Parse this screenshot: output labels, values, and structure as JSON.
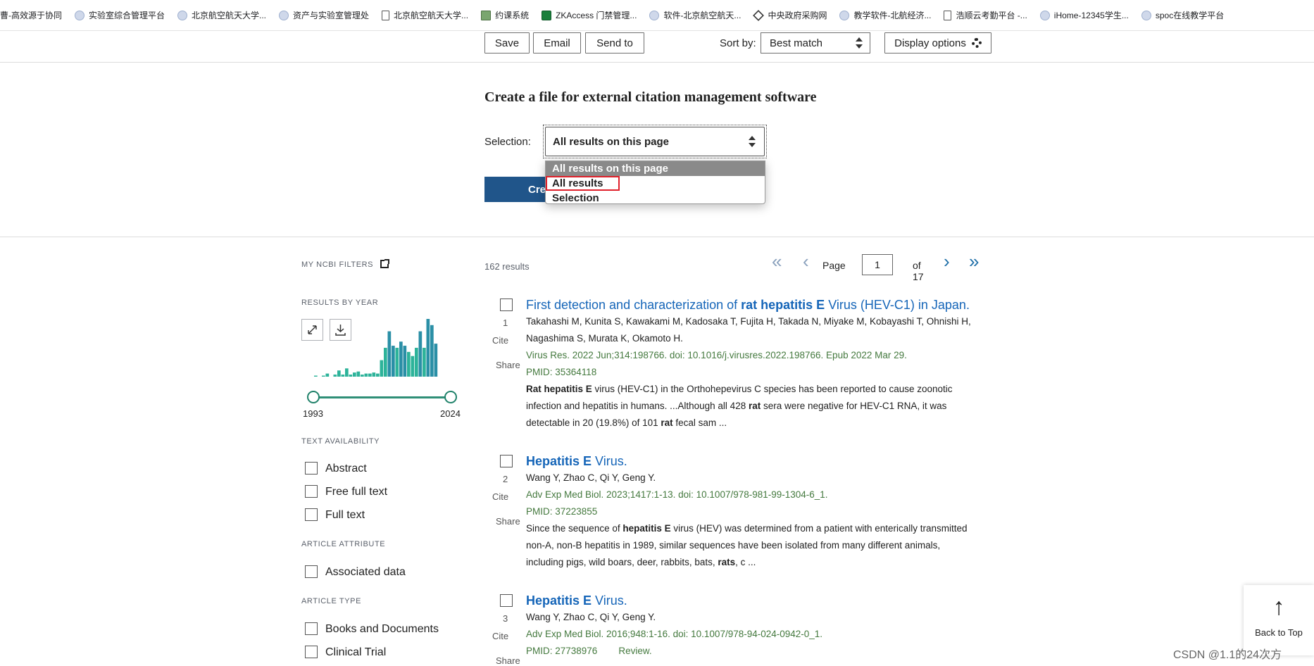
{
  "bookmarks": [
    {
      "label": "曹-高效源于协同",
      "icon": "none"
    },
    {
      "label": "实验室综合管理平台",
      "icon": "globe"
    },
    {
      "label": "北京航空航天大学...",
      "icon": "globe"
    },
    {
      "label": "资产与实验室管理处",
      "icon": "globe"
    },
    {
      "label": "北京航空航天大学...",
      "icon": "doc"
    },
    {
      "label": "约课系统",
      "icon": "img"
    },
    {
      "label": "ZKAccess 门禁管理...",
      "icon": "grn"
    },
    {
      "label": "软件-北京航空航天...",
      "icon": "globe"
    },
    {
      "label": "中央政府采购网",
      "icon": "dia"
    },
    {
      "label": "教学软件-北航经济...",
      "icon": "globe"
    },
    {
      "label": "浩顺云考勤平台 -...",
      "icon": "doc"
    },
    {
      "label": "iHome-12345学生...",
      "icon": "globe"
    },
    {
      "label": "spoc在线教学平台",
      "icon": "globe"
    }
  ],
  "toolbar": {
    "save": "Save",
    "email": "Email",
    "send_to": "Send to",
    "sort_label": "Sort by:",
    "sort_value": "Best match",
    "display_options": "Display options"
  },
  "citation": {
    "title": "Create a file for external citation management software",
    "selection_label": "Selection:",
    "selection_value": "All results on this page",
    "create_label": "Cre",
    "options": [
      "All results on this page",
      "All results",
      "Selection"
    ]
  },
  "sidebar": {
    "my_filters": "MY NCBI FILTERS",
    "results_by_year": "RESULTS BY YEAR",
    "year_start": "1993",
    "year_end": "2024",
    "text_availability": "TEXT AVAILABILITY",
    "text_options": [
      "Abstract",
      "Free full text",
      "Full text"
    ],
    "article_attribute": "ARTICLE ATTRIBUTE",
    "attribute_options": [
      "Associated data"
    ],
    "article_type": "ARTICLE TYPE",
    "type_options": [
      "Books and Documents",
      "Clinical Trial"
    ],
    "year_counts": [
      1,
      0,
      1,
      3,
      0,
      2,
      6,
      2,
      8,
      2,
      4,
      5,
      2,
      3,
      3,
      4,
      3,
      16,
      28,
      44,
      30,
      28,
      34,
      30,
      24,
      20,
      28,
      44,
      28,
      56,
      50,
      32
    ]
  },
  "results": {
    "count": "162 results",
    "page_word": "Page",
    "page_value": "1",
    "of_total": "of 17"
  },
  "articles": [
    {
      "num": "1",
      "cite": "Cite",
      "share": "Share",
      "title_pre": "First detection and characterization of ",
      "title_b1": "rat hepatitis E",
      "title_post": " Virus (HEV-C1) in Japan.",
      "authors1": "Takahashi M, Kunita S, Kawakami M, Kadosaka T, Fujita H, Takada N, Miyake M, Kobayashi T, Ohnishi H,",
      "authors2": "Nagashima S, Murata K, Okamoto H.",
      "journal": "Virus Res. 2022 Jun;314:198766. doi: 10.1016/j.virusres.2022.198766. Epub 2022 Mar 29.",
      "pmid": "PMID: 35364118",
      "snip1_b": "Rat hepatitis E",
      "snip1": " virus (HEV-C1) in the Orthohepevirus C species has been reported to cause zoonotic",
      "snip2_pre": "infection and hepatitis in humans. ...Although all 428 ",
      "snip2_b": "rat",
      "snip2_post": " sera were negative for HEV-C1 RNA, it was",
      "snip3_pre": "detectable in 20 (19.8%) of 101 ",
      "snip3_b": "rat",
      "snip3_post": " fecal sam ..."
    },
    {
      "num": "2",
      "cite": "Cite",
      "share": "Share",
      "title_b1": "Hepatitis E",
      "title_post": " Virus.",
      "authors1": "Wang Y, Zhao C, Qi Y, Geng Y.",
      "journal": "Adv Exp Med Biol. 2023;1417:1-13. doi: 10.1007/978-981-99-1304-6_1.",
      "pmid": "PMID: 37223855",
      "snip1_pre": "Since the sequence of ",
      "snip1_b": "hepatitis E",
      "snip1_post": " virus (HEV) was determined from a patient with enterically transmitted",
      "snip2": "non-A, non-B hepatitis in 1989, similar sequences have been isolated from many different animals,",
      "snip3_pre": "including pigs, wild boars, deer, rabbits, bats, ",
      "snip3_b": "rats",
      "snip3_post": ", c ..."
    },
    {
      "num": "3",
      "cite": "Cite",
      "share": "Share",
      "title_b1": "Hepatitis E",
      "title_post": " Virus.",
      "authors1": "Wang Y, Zhao C, Qi Y, Geng Y.",
      "journal": "Adv Exp Med Biol. 2016;948:1-16. doi: 10.1007/978-94-024-0942-0_1.",
      "pmid": "PMID: 27738976",
      "review": "Review."
    }
  ],
  "back_to_top": "Back to Top",
  "watermark": "CSDN @1.1的24次方"
}
